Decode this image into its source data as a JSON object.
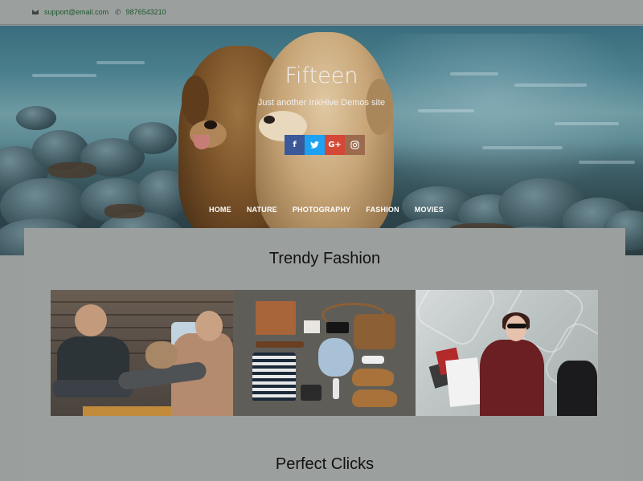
{
  "topbar": {
    "email": "support@email.com",
    "phone": "9876543210",
    "email_icon": "envelope-icon",
    "phone_icon": "phone-icon"
  },
  "header": {
    "title": "Fifteen",
    "tagline": "Just another InkHive Demos site"
  },
  "social": [
    {
      "icon": "facebook-icon",
      "glyph": "f",
      "color": "#3b5998"
    },
    {
      "icon": "twitter-icon",
      "glyph": "t",
      "color": "#1da1f2"
    },
    {
      "icon": "google-plus-icon",
      "glyph": "G+",
      "color": "#d34836"
    },
    {
      "icon": "instagram-icon",
      "glyph": "◎",
      "color": "#9c6b4e"
    }
  ],
  "nav": {
    "items": [
      {
        "label": "HOME"
      },
      {
        "label": "NATURE"
      },
      {
        "label": "PHOTOGRAPHY"
      },
      {
        "label": "FASHION"
      },
      {
        "label": "MOVIES"
      }
    ]
  },
  "sections": [
    {
      "title": "Trendy Fashion"
    },
    {
      "title": "Perfect Clicks"
    }
  ]
}
